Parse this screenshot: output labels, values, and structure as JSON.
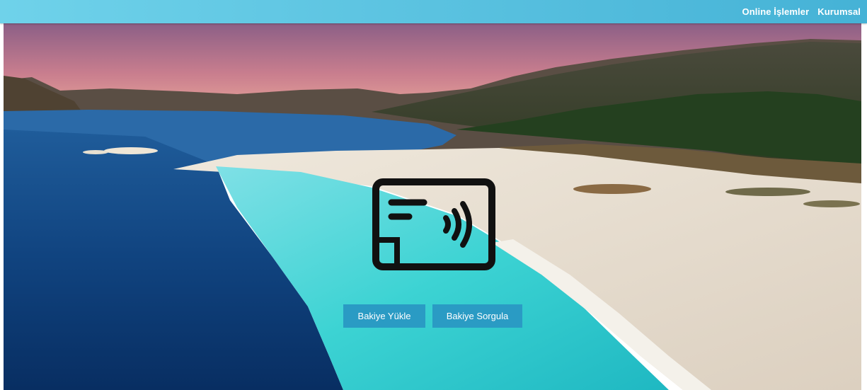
{
  "nav": {
    "items": [
      {
        "label": "Online İşlemler"
      },
      {
        "label": "Kurumsal"
      }
    ]
  },
  "hero": {
    "icon": "contactless-card-icon",
    "buttons": {
      "load_balance": "Bakiye Yükle",
      "check_balance": "Bakiye Sorgula"
    }
  },
  "colors": {
    "topbar_start": "#6fd2ea",
    "topbar_end": "#45b2d6",
    "button": "#2a9bc4",
    "button_text": "#ffffff"
  }
}
